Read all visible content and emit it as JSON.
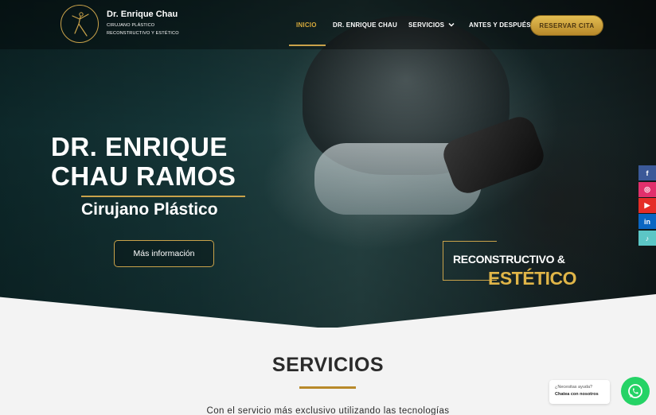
{
  "header": {
    "brand_name": "Dr. Enrique Chau",
    "brand_sub1": "CIRUJANO PLÁSTICO",
    "brand_sub2": "RECONSTRUCTIVO Y ESTÉTICO",
    "nav": [
      {
        "label": "INICIO",
        "active": true
      },
      {
        "label": "DR. ENRIQUE CHAU",
        "active": false
      },
      {
        "label": "SERVICIOS",
        "active": false,
        "has_dropdown": true
      },
      {
        "label": "ANTES Y DESPUÉS",
        "active": false
      }
    ],
    "cta_label": "RESERVAR CITA"
  },
  "hero": {
    "title_line1": "DR. ENRIQUE",
    "title_line2": "CHAU RAMOS",
    "subtitle": "Cirujano Plástico",
    "button_label": "Más información",
    "badge_line1": "RECONSTRUCTIVO &",
    "badge_line2": "ESTÉTICO"
  },
  "social": [
    {
      "icon": "facebook-icon",
      "glyph": "f"
    },
    {
      "icon": "instagram-icon",
      "glyph": "◎"
    },
    {
      "icon": "youtube-icon",
      "glyph": "▶"
    },
    {
      "icon": "linkedin-icon",
      "glyph": "in"
    },
    {
      "icon": "tiktok-icon",
      "glyph": "♪"
    }
  ],
  "services": {
    "title": "SERVICIOS",
    "intro": "Con el servicio más exclusivo utilizando las tecnologías"
  },
  "whatsapp": {
    "line1": "¿Necesitas ayuda?",
    "line2": "Chatea con nosotros"
  },
  "colors": {
    "accent_gold": "#c9a24a",
    "active_nav": "#d6a93b",
    "whatsapp_green": "#25d366"
  }
}
